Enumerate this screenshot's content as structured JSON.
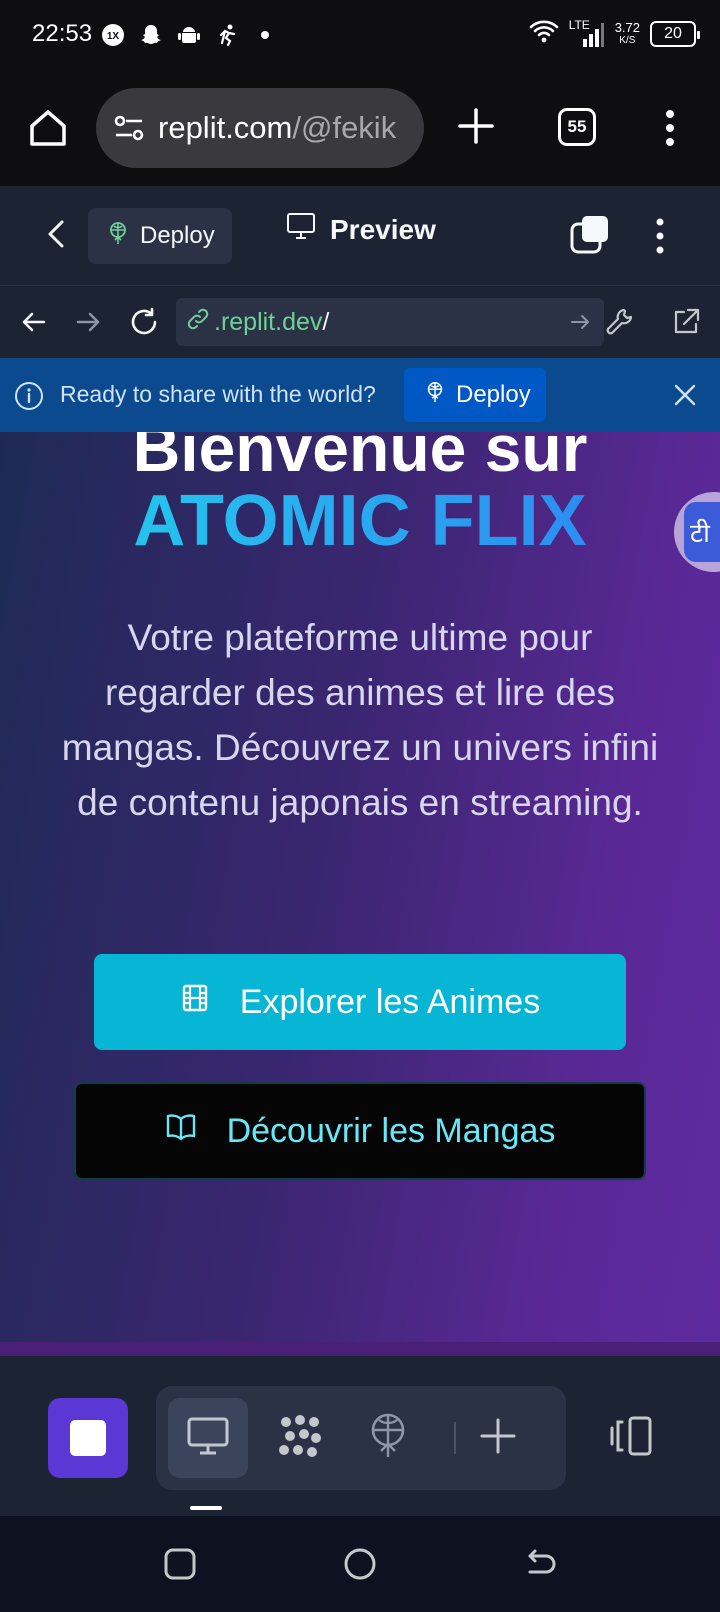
{
  "status_bar": {
    "time": "22:53",
    "network": "LTE",
    "speed_value": "3.72",
    "speed_unit": "K/S",
    "battery": "20",
    "icons": [
      "1x-icon",
      "snapchat-icon",
      "android-icon",
      "running-icon",
      "dot-icon",
      "wifi-icon",
      "signal-icon",
      "battery-icon"
    ]
  },
  "browser": {
    "url_main": "replit.com",
    "url_path": "/@fekik",
    "tab_count": "55"
  },
  "replit_header": {
    "deploy_label": "Deploy",
    "preview_label": "Preview"
  },
  "webview": {
    "url_domain": ".replit.dev",
    "url_path": "/"
  },
  "banner": {
    "text": "Ready to share with the world?",
    "deploy_label": "Deploy"
  },
  "hero": {
    "title_line1": "Bienvenue sur",
    "title_line2": "ATOMIC FLIX",
    "description": "Votre plateforme ultime pour regarder des animes et lire des mangas. Découvrez un univers infini de contenu japonais en streaming.",
    "explore_label": "Explorer les Animes",
    "manga_label": "Découvrir les Mangas",
    "floating_glyph": "टी"
  },
  "colors": {
    "accent_cyan": "#06b6d4",
    "title_gradient_start": "#22d3ee",
    "title_gradient_end": "#2f7ef0",
    "replit_bg": "#1c2333",
    "banner_bg": "#0c4a8f",
    "stop_button": "#5b38d6"
  }
}
